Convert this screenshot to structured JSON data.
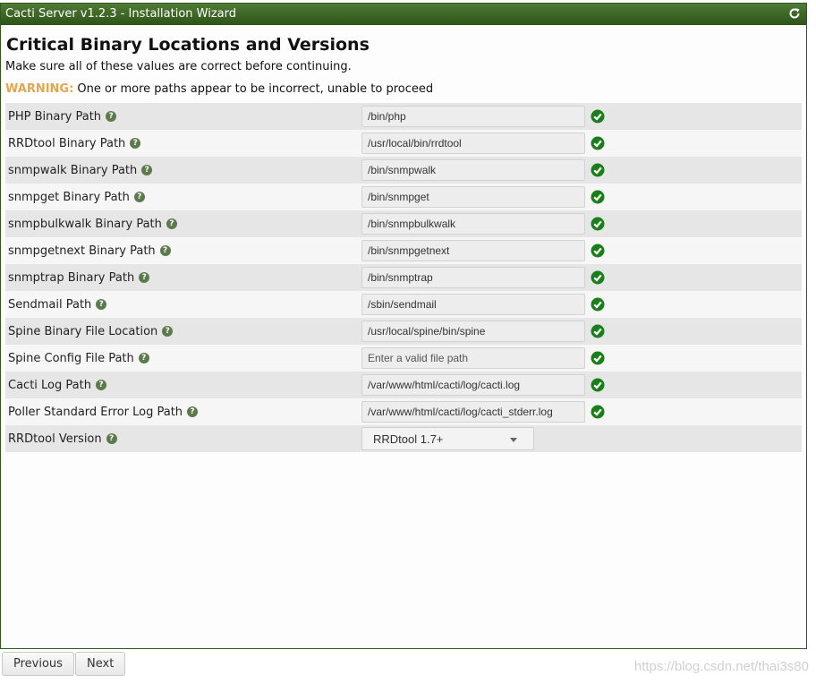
{
  "window": {
    "title": "Cacti Server v1.2.3 - Installation Wizard"
  },
  "page": {
    "heading": "Critical Binary Locations and Versions",
    "intro": "Make sure all of these values are correct before continuing.",
    "warning_label": "WARNING:",
    "warning_text": " One or more paths appear to be incorrect, unable to proceed"
  },
  "rows": [
    {
      "label": "PHP Binary Path",
      "value": "/bin/php",
      "placeholder": ""
    },
    {
      "label": "RRDtool Binary Path",
      "value": "/usr/local/bin/rrdtool",
      "placeholder": ""
    },
    {
      "label": "snmpwalk Binary Path",
      "value": "/bin/snmpwalk",
      "placeholder": ""
    },
    {
      "label": "snmpget Binary Path",
      "value": "/bin/snmpget",
      "placeholder": ""
    },
    {
      "label": "snmpbulkwalk Binary Path",
      "value": "/bin/snmpbulkwalk",
      "placeholder": ""
    },
    {
      "label": "snmpgetnext Binary Path",
      "value": "/bin/snmpgetnext",
      "placeholder": ""
    },
    {
      "label": "snmptrap Binary Path",
      "value": "/bin/snmptrap",
      "placeholder": ""
    },
    {
      "label": "Sendmail Path",
      "value": "/sbin/sendmail",
      "placeholder": ""
    },
    {
      "label": "Spine Binary File Location",
      "value": "/usr/local/spine/bin/spine",
      "placeholder": ""
    },
    {
      "label": "Spine Config File Path",
      "value": "",
      "placeholder": "Enter a valid file path"
    },
    {
      "label": "Cacti Log Path",
      "value": "/var/www/html/cacti/log/cacti.log",
      "placeholder": ""
    },
    {
      "label": "Poller Standard Error Log Path",
      "value": "/var/www/html/cacti/log/cacti_stderr.log",
      "placeholder": ""
    }
  ],
  "rrdtool_version": {
    "label": "RRDtool Version",
    "selected": "RRDtool 1.7+"
  },
  "footer": {
    "previous_label": "Previous",
    "next_label": "Next",
    "watermark": "https://blog.csdn.net/thai3s80"
  },
  "icons": {
    "refresh": "refresh-icon",
    "help": "help-icon",
    "check": "check-circle-icon"
  },
  "colors": {
    "titlebar": "#3b6626",
    "check": "#1a7f1a",
    "warning": "#e6a64a"
  }
}
